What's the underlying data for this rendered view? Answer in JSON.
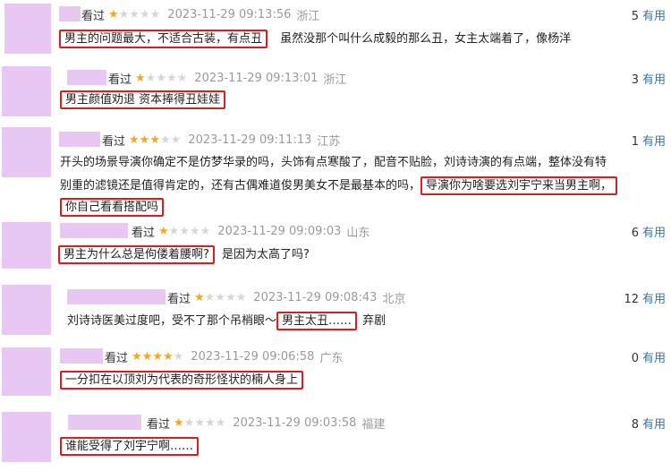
{
  "reviews": [
    {
      "watched": "看过",
      "stars": 1,
      "time": "2023-11-29 09:13:56",
      "location": "浙江",
      "count": "5",
      "useful": "有用",
      "highlight": "男主的问题最大，不适合古装，有点丑",
      "rest": "虽然没那个叫什么成毅的那么丑，女主太端着了，像杨洋"
    },
    {
      "watched": "看过",
      "stars": 1,
      "time": "2023-11-29 09:13:01",
      "location": "浙江",
      "count": "3",
      "useful": "有用",
      "highlight": "男主颜值劝退 资本捧得丑娃娃",
      "rest": ""
    },
    {
      "watched": "看过",
      "stars": 3,
      "time": "2023-11-29 09:11:13",
      "location": "江苏",
      "count": "1",
      "useful": "有用",
      "line1": "开头的场景导演你确定不是仿梦华录的吗，头饰有点寒酸了，配音不贴脸，刘诗诗演的有点端，整体没有特",
      "line2a": "别重的滤镜还是值得肯定的，还有古偶难道俊男美女不是最基本的吗，",
      "hl2": "导演你为啥要选刘宇宁来当男主啊，",
      "hl3": "你自己看看搭配吗"
    },
    {
      "watched": "看过",
      "stars": 1,
      "time": "2023-11-29 09:09:03",
      "location": "山东",
      "count": "6",
      "useful": "有用",
      "highlight": "男主为什么总是佝偻着腰啊?",
      "rest": "是因为太高了吗?"
    },
    {
      "watched": "看过",
      "stars": 1,
      "time": "2023-11-29 09:08:43",
      "location": "北京",
      "count": "12",
      "useful": "有用",
      "prefix": "刘诗诗医美过度吧，受不了那个吊梢眼～",
      "highlight": "男主太丑……",
      "rest": "弃剧"
    },
    {
      "watched": "看过",
      "stars": 4,
      "time": "2023-11-29 09:06:58",
      "location": "广东",
      "count": "0",
      "useful": "有用",
      "highlight": "一分扣在以顶刘为代表的奇形怪状的楠人身上",
      "rest": ""
    },
    {
      "watched": "看过",
      "stars": 1,
      "time": "2023-11-29 09:03:58",
      "location": "福建",
      "count": "8",
      "useful": "有用",
      "highlight": "谁能受得了刘宇宁啊……",
      "rest": ""
    }
  ]
}
